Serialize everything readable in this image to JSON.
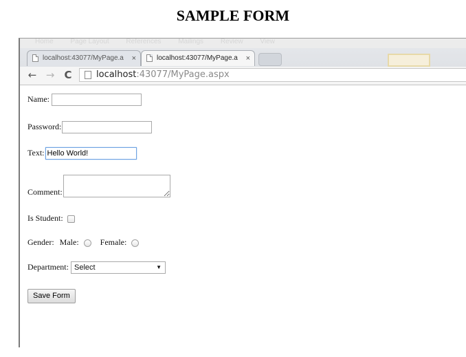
{
  "document": {
    "title": "SAMPLE FORM"
  },
  "browser": {
    "menu_items": [
      "Home",
      "Page Layout",
      "References",
      "Mailings",
      "Review",
      "View"
    ],
    "tabs": [
      {
        "label": "localhost:43077/MyPage.a",
        "close": "×"
      },
      {
        "label": "localhost:43077/MyPage.a",
        "close": "×"
      }
    ],
    "nav": {
      "back": "←",
      "forward": "→",
      "reload": "C"
    },
    "address": {
      "host": "localhost",
      "rest": ":43077/MyPage.aspx"
    }
  },
  "form": {
    "name": {
      "label": "Name:",
      "value": ""
    },
    "password": {
      "label": "Password:",
      "value": ""
    },
    "text": {
      "label": "Text:",
      "value": "Hello World!"
    },
    "comment": {
      "label": "Comment:",
      "value": ""
    },
    "is_student": {
      "label": "Is Student:",
      "checked": false
    },
    "gender": {
      "label": "Gender:",
      "male_label": "Male:",
      "female_label": "Female:"
    },
    "department": {
      "label": "Department:",
      "selected": "Select",
      "arrow": "▼"
    },
    "save_label": "Save Form"
  }
}
